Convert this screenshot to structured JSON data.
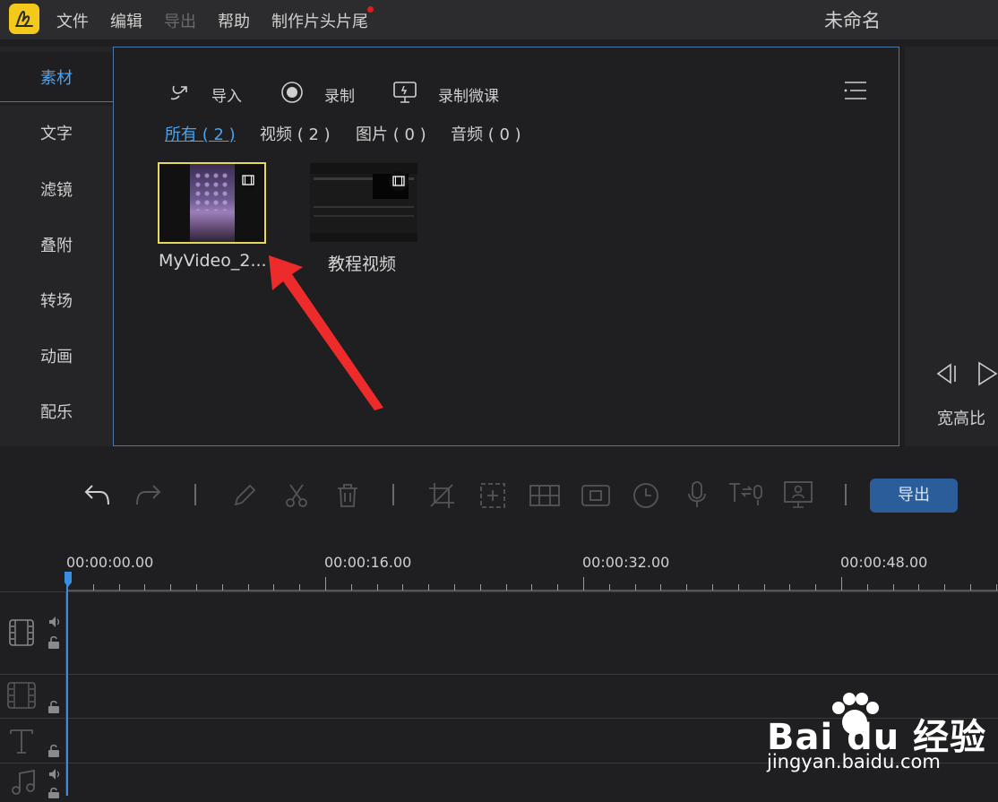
{
  "app": {
    "logo_icon": "app-logo-icon",
    "project_title": "未命名"
  },
  "menu": {
    "file": "文件",
    "edit": "编辑",
    "export": "导出",
    "help": "帮助",
    "intro_outro": "制作片头片尾"
  },
  "sidebar": {
    "items": [
      {
        "label": "素材",
        "active": true
      },
      {
        "label": "文字"
      },
      {
        "label": "滤镜"
      },
      {
        "label": "叠附"
      },
      {
        "label": "转场"
      },
      {
        "label": "动画"
      },
      {
        "label": "配乐"
      }
    ]
  },
  "media": {
    "import_label": "导入",
    "record_label": "录制",
    "record_lesson_label": "录制微课",
    "filters": {
      "all": "所有 ( 2 )",
      "video": "视频 ( 2 )",
      "image": "图片 ( 0 )",
      "audio": "音频 ( 0 )"
    },
    "items": [
      {
        "name": "MyVideo_2...",
        "selected": true
      },
      {
        "name": "教程视频"
      }
    ]
  },
  "preview": {
    "aspect_label": "宽高比"
  },
  "toolbar": {
    "export_label": "导出",
    "accent_color": "#2a5d9a"
  },
  "timeline": {
    "time_labels": [
      "00:00:00.00",
      "00:00:16.00",
      "00:00:32.00",
      "00:00:48.00"
    ]
  },
  "watermark": {
    "brand": "Bai du 经验",
    "url": "jingyan.baidu.com"
  }
}
